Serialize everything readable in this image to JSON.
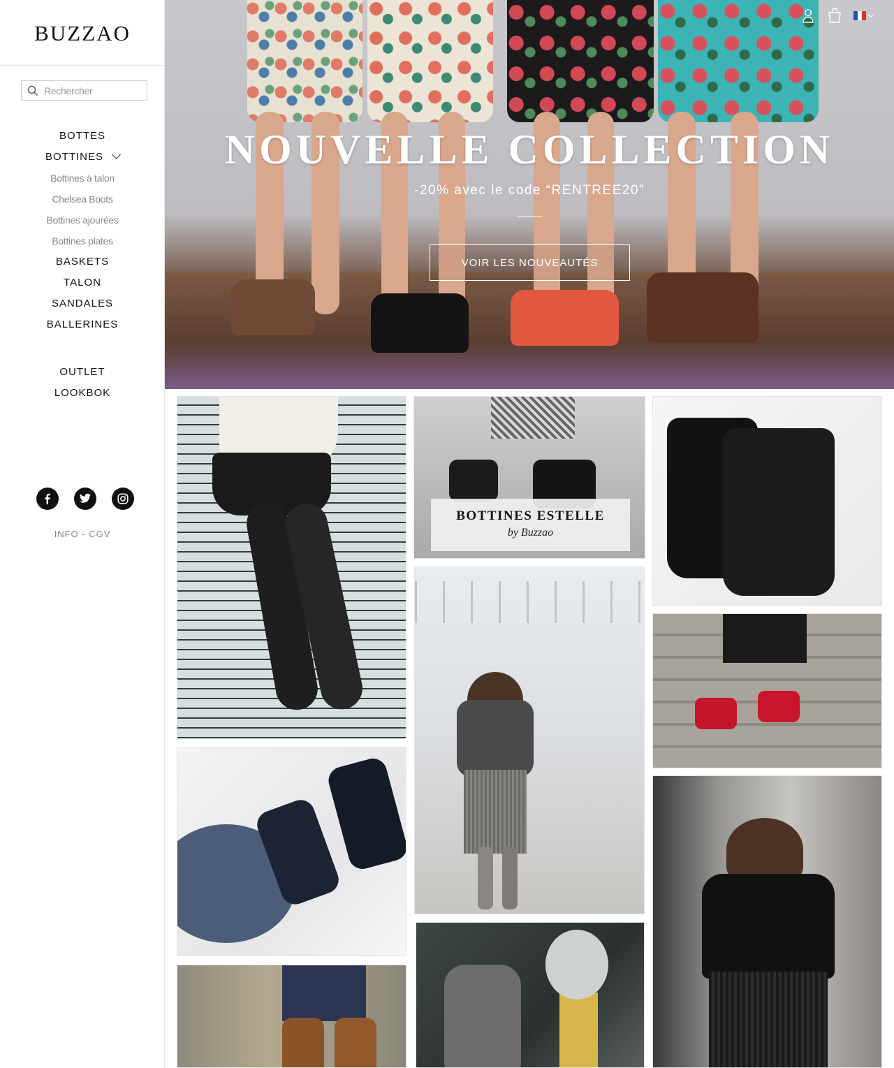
{
  "brand": {
    "logo": "BUZZAO"
  },
  "search": {
    "placeholder": "Rechercher"
  },
  "nav": {
    "main": [
      {
        "label": "BOTTES"
      },
      {
        "label": "BOTTINES",
        "expanded": true
      }
    ],
    "bottines_sub": [
      {
        "label": "Bottines à talon"
      },
      {
        "label": "Chelsea Boots"
      },
      {
        "label": "Bottines ajourées"
      },
      {
        "label": "Bottines plates"
      }
    ],
    "more": [
      {
        "label": "BASKETS"
      },
      {
        "label": "TALON"
      },
      {
        "label": "SANDALES"
      },
      {
        "label": "BALLERINES"
      }
    ],
    "secondary": [
      {
        "label": "OUTLET"
      },
      {
        "label": "LOOKBOK"
      }
    ]
  },
  "social": [
    "facebook-icon",
    "twitter-icon",
    "instagram-icon"
  ],
  "footer_links": {
    "info": "INFO",
    "separator": " - ",
    "cgv": "CGV"
  },
  "hero": {
    "title": "NOUVELLE COLLECTION",
    "subtitle": "-20% avec le code “RENTREE20”",
    "cta": "VOIR LES NOUVEAUTÉS"
  },
  "topbar": {
    "icons": [
      "user-icon",
      "cart-icon",
      "flag-fr-icon"
    ]
  },
  "featured": {
    "title": "BOTTINES ESTELLE",
    "subtitle": "by Buzzao"
  },
  "colors": {
    "accent": "#111111",
    "muted": "#888888",
    "hero_text": "#ffffff",
    "flag_blue": "#2a4fa8",
    "flag_red": "#d8323c"
  }
}
